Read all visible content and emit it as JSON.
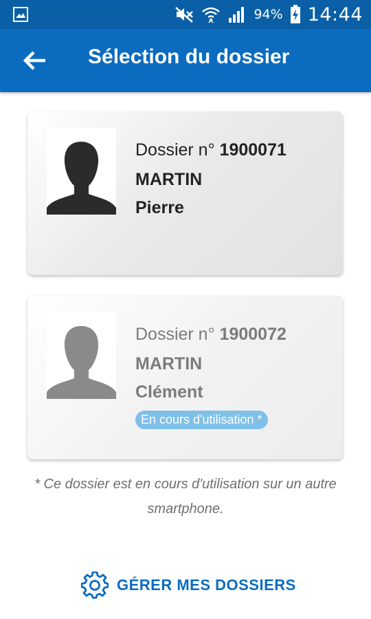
{
  "status_bar": {
    "battery_percent": "94%",
    "time": "14:44",
    "icons": [
      "image-notification-icon",
      "mute-icon",
      "wifi-icon",
      "signal-icon",
      "battery-charging-icon"
    ]
  },
  "app_bar": {
    "title": "Sélection du dossier",
    "back_icon": "arrow-left-icon"
  },
  "dossiers": [
    {
      "prefix": "Dossier n° ",
      "number": "1900071",
      "last_name": "MARTIN",
      "first_name": "Pierre",
      "badge": "",
      "active": true
    },
    {
      "prefix": "Dossier n° ",
      "number": "1900072",
      "last_name": "MARTIN",
      "first_name": "Clément",
      "badge": "En cours d'utilisation *",
      "active": false
    }
  ],
  "footnote": "* Ce dossier est en cours d'utilisation sur un autre smartphone.",
  "manage_button": {
    "label": "GÉRER MES DOSSIERS",
    "icon": "gear-icon"
  },
  "colors": {
    "primary": "#0b6bbf",
    "status_bar": "#0a5fa6",
    "badge": "#7fc0e8",
    "avatar_active": "#2b2b2b",
    "avatar_inactive": "#8a8a8a"
  }
}
